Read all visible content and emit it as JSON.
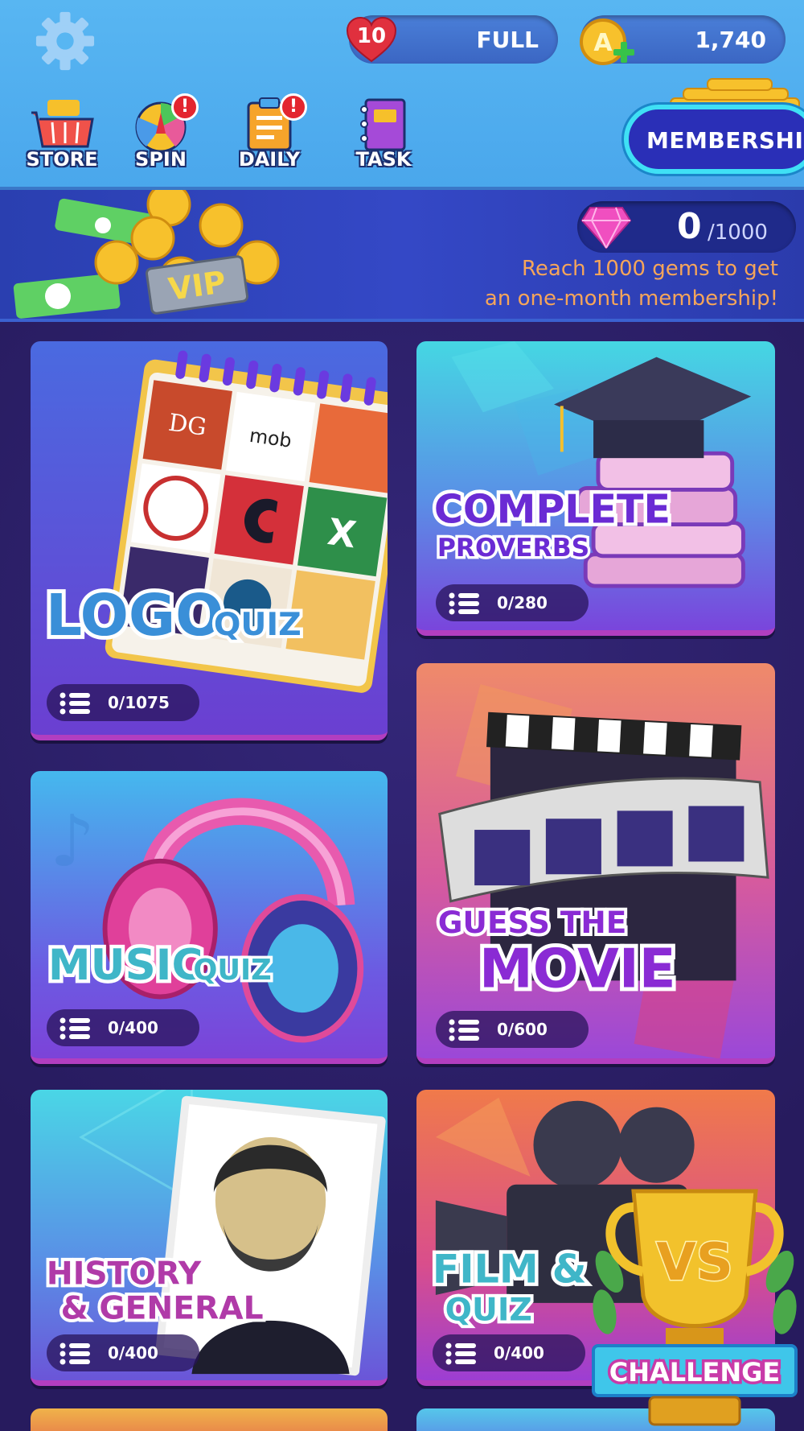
{
  "header": {
    "lives": {
      "count": "10",
      "status": "FULL"
    },
    "coins": {
      "amount": "1,740"
    },
    "nav": [
      {
        "label": "STORE",
        "has_alert": false
      },
      {
        "label": "SPIN",
        "has_alert": true
      },
      {
        "label": "DAILY",
        "has_alert": true
      },
      {
        "label": "TASK",
        "has_alert": false
      }
    ],
    "alert_glyph": "!",
    "membership_label": "MEMBERSHIP"
  },
  "banner": {
    "vip_label": "VIP",
    "coin_letter": "A",
    "gems": {
      "count": "0",
      "total": "/1000"
    },
    "message_line1": "Reach 1000 gems to get",
    "message_line2": "an one-month membership!"
  },
  "categories": [
    {
      "id": "logo",
      "title_big": "LOGO",
      "title_small": "QUIZ",
      "progress": "0/1075",
      "tiles": {
        "dg": "DG",
        "mob": "mob",
        "excel": "X"
      }
    },
    {
      "id": "proverbs",
      "title_big": "COMPLETE",
      "title_small": "PROVERBS",
      "progress": "0/280"
    },
    {
      "id": "music",
      "title_big": "MUSIC",
      "title_small": "QUIZ",
      "progress": "0/400"
    },
    {
      "id": "movie",
      "title_small": "GUESS THE",
      "title_big": "MOVIE",
      "progress": "0/600"
    },
    {
      "id": "history",
      "title_line1": "HISTORY",
      "title_line2": "& GENERAL",
      "progress": "0/400"
    },
    {
      "id": "film",
      "title_line1": "FILM &",
      "title_line2": "QUIZ",
      "progress": "0/400"
    }
  ],
  "challenge": {
    "label": "CHALLENGE",
    "vs": "VS"
  },
  "colors": {
    "topbar": "#58b6f2",
    "heart": "#e0303e",
    "coin": "#f7c12c",
    "gem": "#f04fc0",
    "gem_message": "#f5a55a",
    "title_purple": "#6a2bd4",
    "title_teal": "#3fb6c8"
  }
}
